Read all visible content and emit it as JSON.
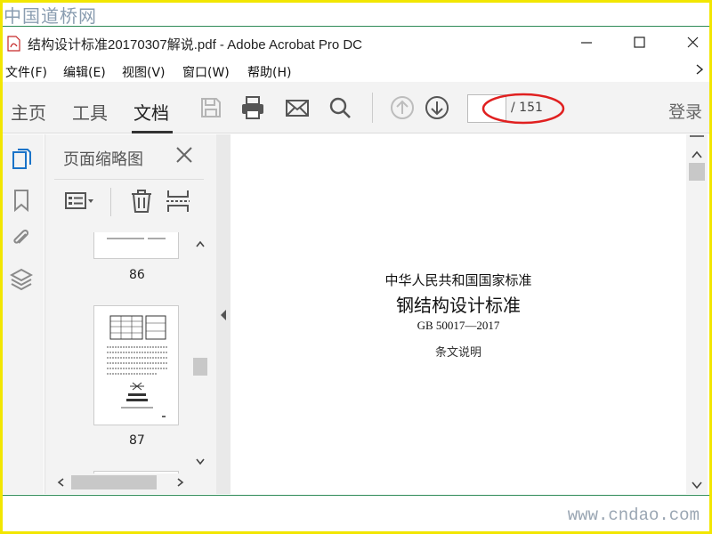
{
  "watermark": {
    "top": "中国道桥网",
    "bottom": "www.cndao.com"
  },
  "window": {
    "title": "结构设计标准20170307解说.pdf - Adobe Acrobat Pro DC"
  },
  "menu": [
    {
      "label": "文件(F)"
    },
    {
      "label": "编辑(E)"
    },
    {
      "label": "视图(V)"
    },
    {
      "label": "窗口(W)"
    },
    {
      "label": "帮助(H)"
    }
  ],
  "toolbar": {
    "tabs": [
      {
        "label": "主页"
      },
      {
        "label": "工具"
      },
      {
        "label": "文档"
      }
    ],
    "active_tab": "文档",
    "page_input": {
      "value": ""
    },
    "page_total": "/ 151",
    "login": "登录",
    "icons": [
      "save-icon",
      "print-icon",
      "mail-icon",
      "search-icon",
      "page-up-icon",
      "page-down-icon"
    ]
  },
  "rail": {
    "icons": [
      "page-thumbnails-icon",
      "bookmark-icon",
      "attachment-icon",
      "layers-icon"
    ]
  },
  "thumbnail_panel": {
    "title": "页面缩略图",
    "pages": [
      {
        "label": "86"
      },
      {
        "label": "87"
      }
    ]
  },
  "document": {
    "lines": [
      "中华人民共和国国家标准",
      "钢结构设计标准",
      "GB 50017—2017",
      "条文说明"
    ]
  },
  "colors": {
    "accent": "#1a73c8",
    "highlight_ring": "#e02020",
    "frame": "#f2e600",
    "rule": "#2e8b57"
  }
}
